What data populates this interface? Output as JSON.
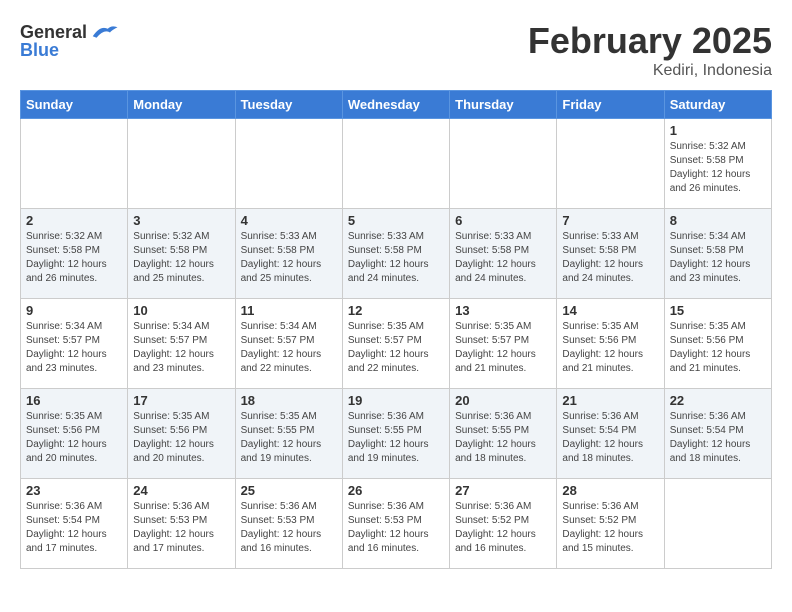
{
  "logo": {
    "general": "General",
    "blue": "Blue"
  },
  "header": {
    "month": "February 2025",
    "location": "Kediri, Indonesia"
  },
  "weekdays": [
    "Sunday",
    "Monday",
    "Tuesday",
    "Wednesday",
    "Thursday",
    "Friday",
    "Saturday"
  ],
  "weeks": [
    [
      {
        "day": "",
        "info": ""
      },
      {
        "day": "",
        "info": ""
      },
      {
        "day": "",
        "info": ""
      },
      {
        "day": "",
        "info": ""
      },
      {
        "day": "",
        "info": ""
      },
      {
        "day": "",
        "info": ""
      },
      {
        "day": "1",
        "info": "Sunrise: 5:32 AM\nSunset: 5:58 PM\nDaylight: 12 hours\nand 26 minutes."
      }
    ],
    [
      {
        "day": "2",
        "info": "Sunrise: 5:32 AM\nSunset: 5:58 PM\nDaylight: 12 hours\nand 26 minutes."
      },
      {
        "day": "3",
        "info": "Sunrise: 5:32 AM\nSunset: 5:58 PM\nDaylight: 12 hours\nand 25 minutes."
      },
      {
        "day": "4",
        "info": "Sunrise: 5:33 AM\nSunset: 5:58 PM\nDaylight: 12 hours\nand 25 minutes."
      },
      {
        "day": "5",
        "info": "Sunrise: 5:33 AM\nSunset: 5:58 PM\nDaylight: 12 hours\nand 24 minutes."
      },
      {
        "day": "6",
        "info": "Sunrise: 5:33 AM\nSunset: 5:58 PM\nDaylight: 12 hours\nand 24 minutes."
      },
      {
        "day": "7",
        "info": "Sunrise: 5:33 AM\nSunset: 5:58 PM\nDaylight: 12 hours\nand 24 minutes."
      },
      {
        "day": "8",
        "info": "Sunrise: 5:34 AM\nSunset: 5:58 PM\nDaylight: 12 hours\nand 23 minutes."
      }
    ],
    [
      {
        "day": "9",
        "info": "Sunrise: 5:34 AM\nSunset: 5:57 PM\nDaylight: 12 hours\nand 23 minutes."
      },
      {
        "day": "10",
        "info": "Sunrise: 5:34 AM\nSunset: 5:57 PM\nDaylight: 12 hours\nand 23 minutes."
      },
      {
        "day": "11",
        "info": "Sunrise: 5:34 AM\nSunset: 5:57 PM\nDaylight: 12 hours\nand 22 minutes."
      },
      {
        "day": "12",
        "info": "Sunrise: 5:35 AM\nSunset: 5:57 PM\nDaylight: 12 hours\nand 22 minutes."
      },
      {
        "day": "13",
        "info": "Sunrise: 5:35 AM\nSunset: 5:57 PM\nDaylight: 12 hours\nand 21 minutes."
      },
      {
        "day": "14",
        "info": "Sunrise: 5:35 AM\nSunset: 5:56 PM\nDaylight: 12 hours\nand 21 minutes."
      },
      {
        "day": "15",
        "info": "Sunrise: 5:35 AM\nSunset: 5:56 PM\nDaylight: 12 hours\nand 21 minutes."
      }
    ],
    [
      {
        "day": "16",
        "info": "Sunrise: 5:35 AM\nSunset: 5:56 PM\nDaylight: 12 hours\nand 20 minutes."
      },
      {
        "day": "17",
        "info": "Sunrise: 5:35 AM\nSunset: 5:56 PM\nDaylight: 12 hours\nand 20 minutes."
      },
      {
        "day": "18",
        "info": "Sunrise: 5:35 AM\nSunset: 5:55 PM\nDaylight: 12 hours\nand 19 minutes."
      },
      {
        "day": "19",
        "info": "Sunrise: 5:36 AM\nSunset: 5:55 PM\nDaylight: 12 hours\nand 19 minutes."
      },
      {
        "day": "20",
        "info": "Sunrise: 5:36 AM\nSunset: 5:55 PM\nDaylight: 12 hours\nand 18 minutes."
      },
      {
        "day": "21",
        "info": "Sunrise: 5:36 AM\nSunset: 5:54 PM\nDaylight: 12 hours\nand 18 minutes."
      },
      {
        "day": "22",
        "info": "Sunrise: 5:36 AM\nSunset: 5:54 PM\nDaylight: 12 hours\nand 18 minutes."
      }
    ],
    [
      {
        "day": "23",
        "info": "Sunrise: 5:36 AM\nSunset: 5:54 PM\nDaylight: 12 hours\nand 17 minutes."
      },
      {
        "day": "24",
        "info": "Sunrise: 5:36 AM\nSunset: 5:53 PM\nDaylight: 12 hours\nand 17 minutes."
      },
      {
        "day": "25",
        "info": "Sunrise: 5:36 AM\nSunset: 5:53 PM\nDaylight: 12 hours\nand 16 minutes."
      },
      {
        "day": "26",
        "info": "Sunrise: 5:36 AM\nSunset: 5:53 PM\nDaylight: 12 hours\nand 16 minutes."
      },
      {
        "day": "27",
        "info": "Sunrise: 5:36 AM\nSunset: 5:52 PM\nDaylight: 12 hours\nand 16 minutes."
      },
      {
        "day": "28",
        "info": "Sunrise: 5:36 AM\nSunset: 5:52 PM\nDaylight: 12 hours\nand 15 minutes."
      },
      {
        "day": "",
        "info": ""
      }
    ]
  ]
}
